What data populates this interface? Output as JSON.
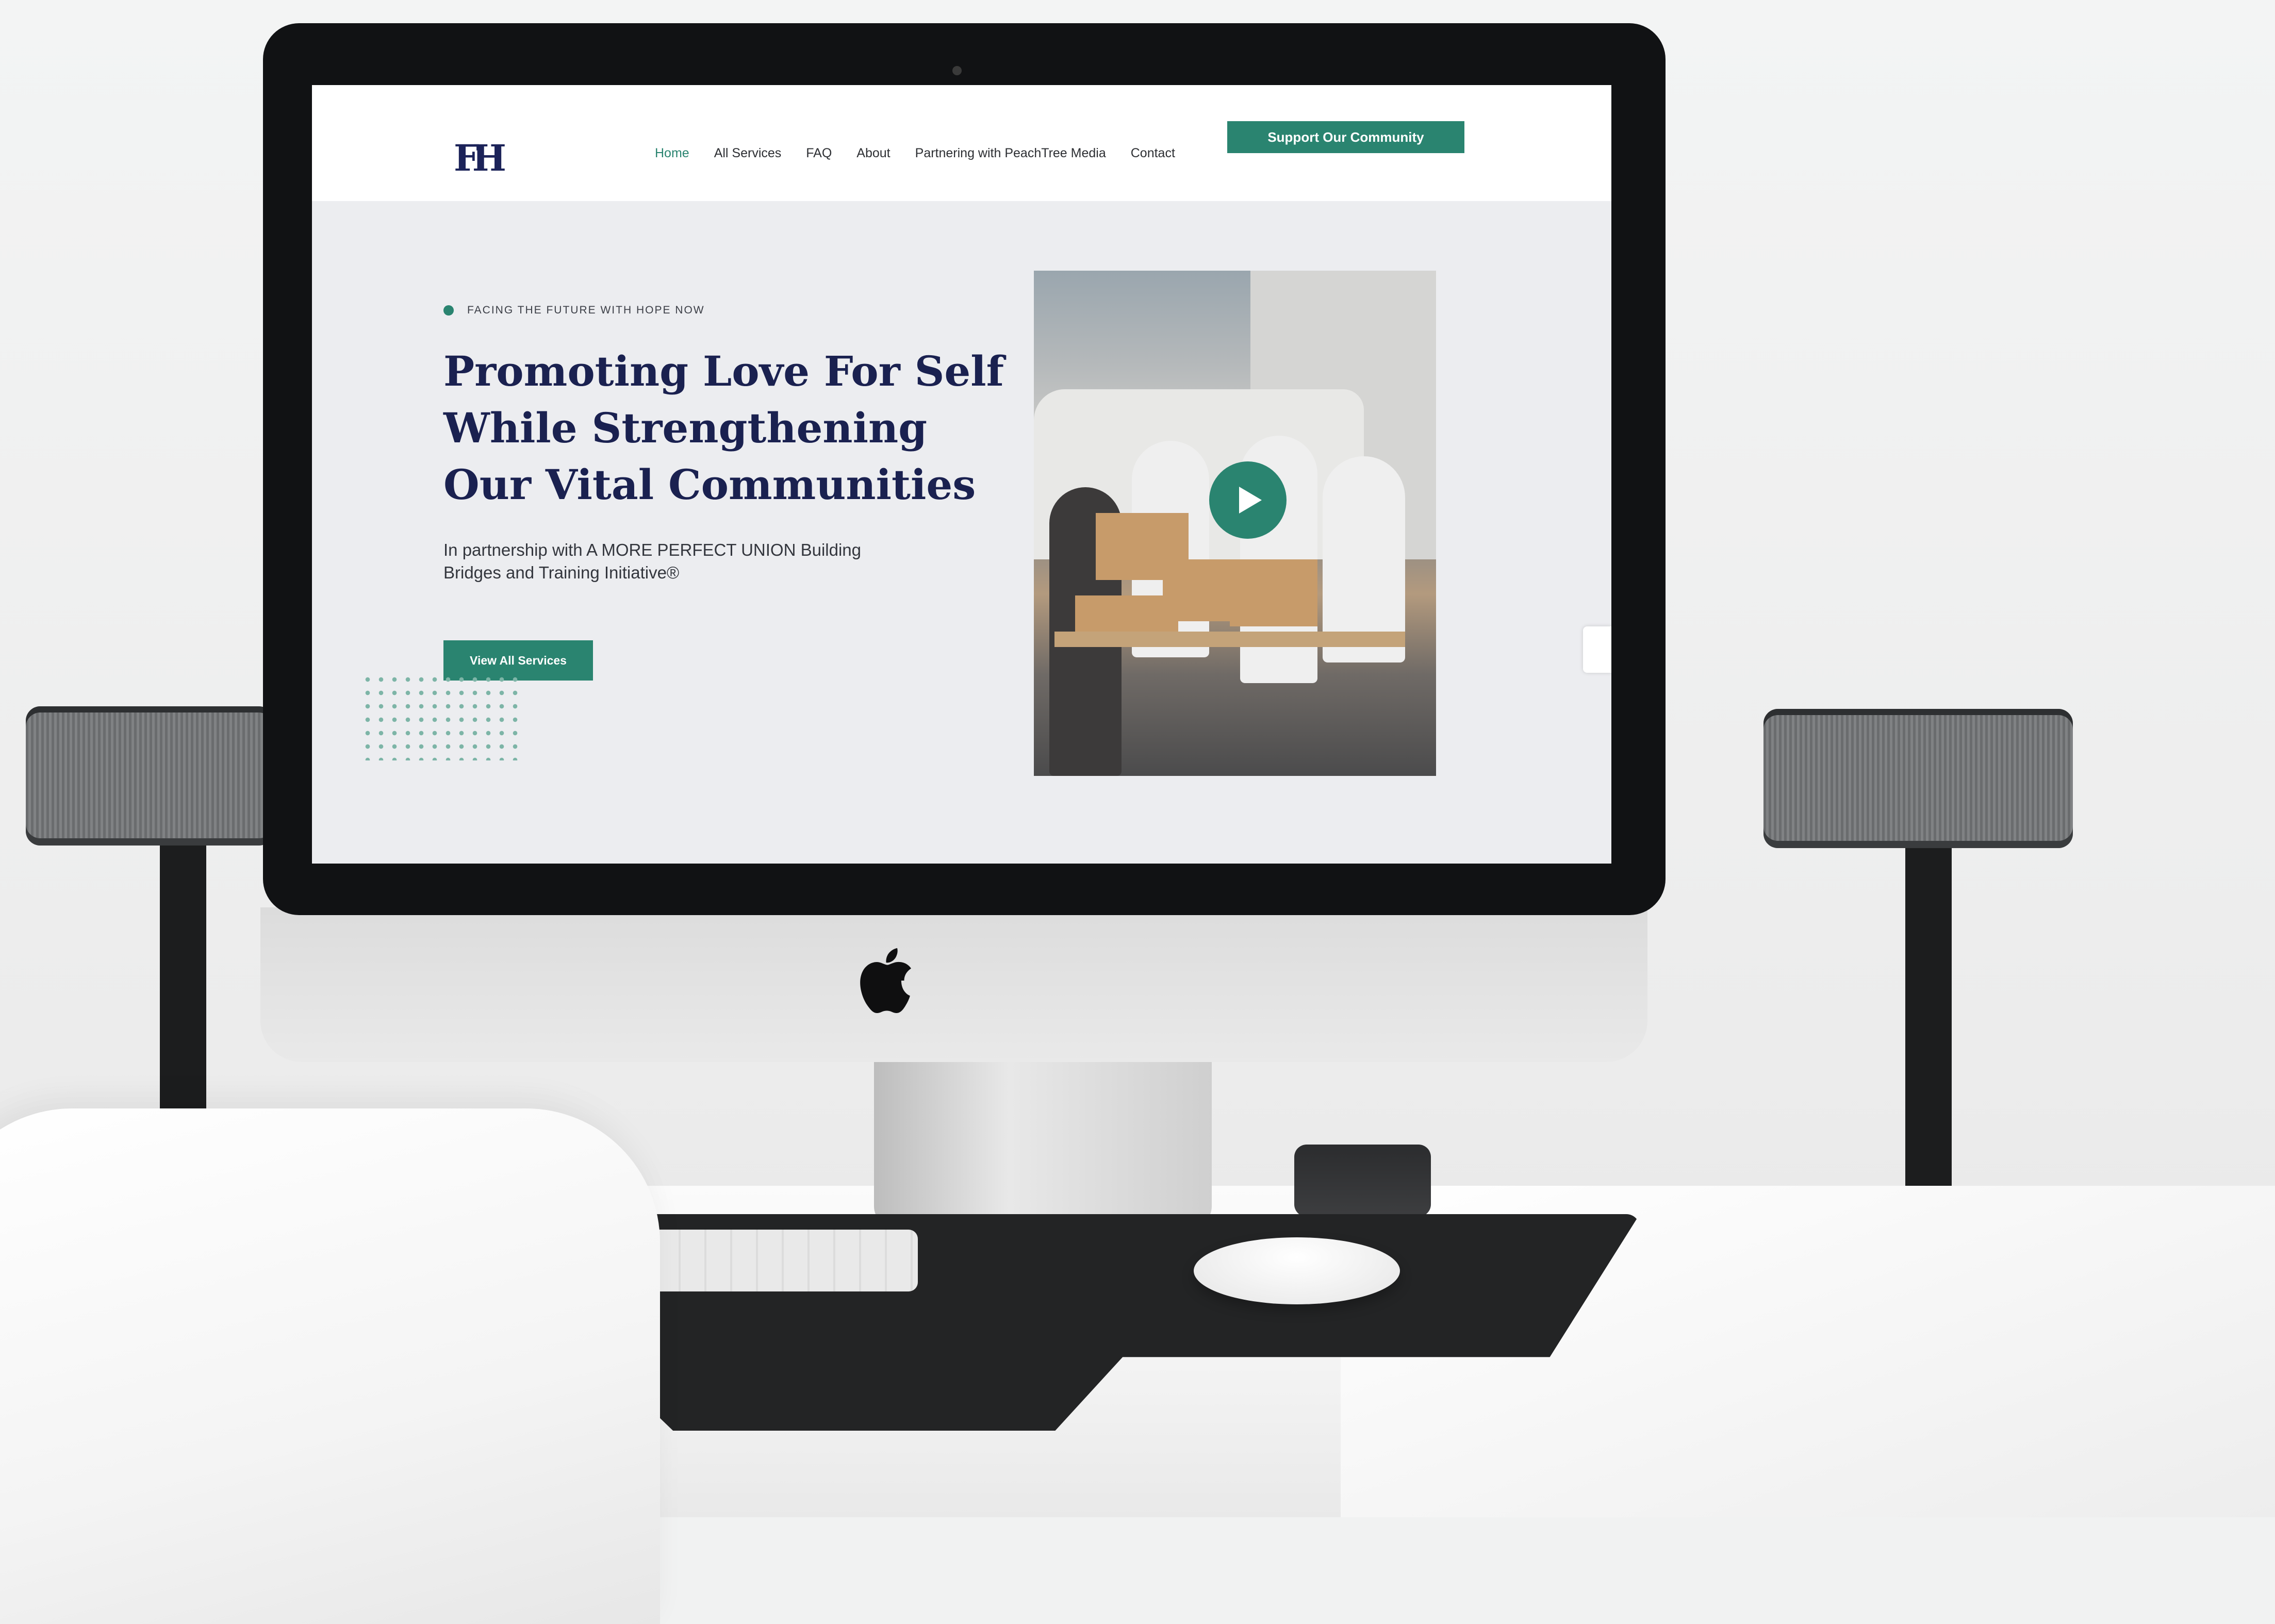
{
  "site": {
    "logo_text": "FH",
    "nav": {
      "links": [
        {
          "label": "Home",
          "active": true
        },
        {
          "label": "All Services",
          "active": false
        },
        {
          "label": "FAQ",
          "active": false
        },
        {
          "label": "About",
          "active": false
        },
        {
          "label": "Partnering with PeachTree Media",
          "active": false
        },
        {
          "label": "Contact",
          "active": false
        }
      ],
      "cta_label": "Support Our Community"
    },
    "hero": {
      "eyebrow": "FACING THE FUTURE WITH HOPE NOW",
      "headline_lines": [
        "Promoting Love For Self",
        "While Strengthening",
        "Our Vital Communities"
      ],
      "subtext": "In partnership with A MORE PERFECT UNION Building Bridges and Training Initiative®",
      "button_label": "View All Services",
      "video_icon": "play-icon"
    }
  },
  "colors": {
    "accent": "#2a8470",
    "headline": "#1a2150",
    "page_bg": "#ecedf0"
  }
}
